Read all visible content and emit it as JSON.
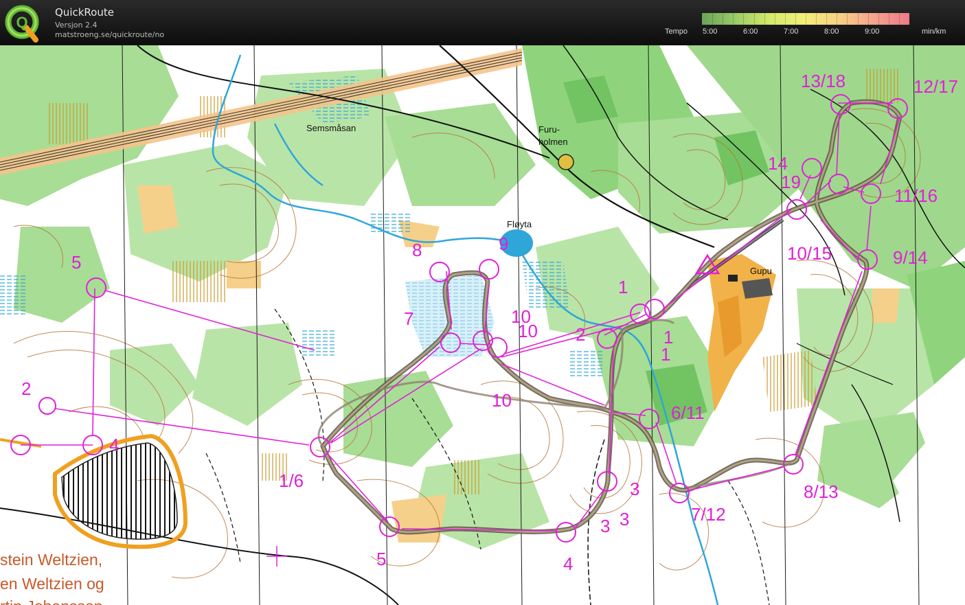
{
  "header": {
    "app_title": "QuickRoute",
    "version": "Versjon 2.4",
    "url": "matstroeng.se/quickroute/no",
    "logo_letter": "Q"
  },
  "legend": {
    "label": "Tempo",
    "ticks": [
      "5:00",
      "6:00",
      "7:00",
      "8:00",
      "9:00"
    ],
    "unit": "min/km"
  },
  "map": {
    "place_names": [
      "Semsmåsan",
      "Furu-",
      "holmen",
      "Fløyta",
      "Gupu"
    ],
    "control_labels": [
      "13/18",
      "12/17",
      "14",
      "19",
      "11/16",
      "10/15",
      "9/14",
      "5",
      "8",
      "9",
      "1",
      "2",
      "1",
      "1",
      "10",
      "10",
      "7",
      "2",
      "10",
      "4",
      "6/11",
      "1/6",
      "3",
      "3",
      "3",
      "7/12",
      "8/13",
      "5",
      "4"
    ],
    "credits": [
      "stein Weltzien,",
      "en Weltzien  og",
      "rtin Johansson"
    ]
  },
  "colors": {
    "course": "#e020d8",
    "route": "#7d7060",
    "water": "#2ea6d8",
    "forest": "#9fd88c",
    "open_land": "#f1b24a",
    "contour": "#b5763c",
    "credit_text": "#c65a2a"
  }
}
